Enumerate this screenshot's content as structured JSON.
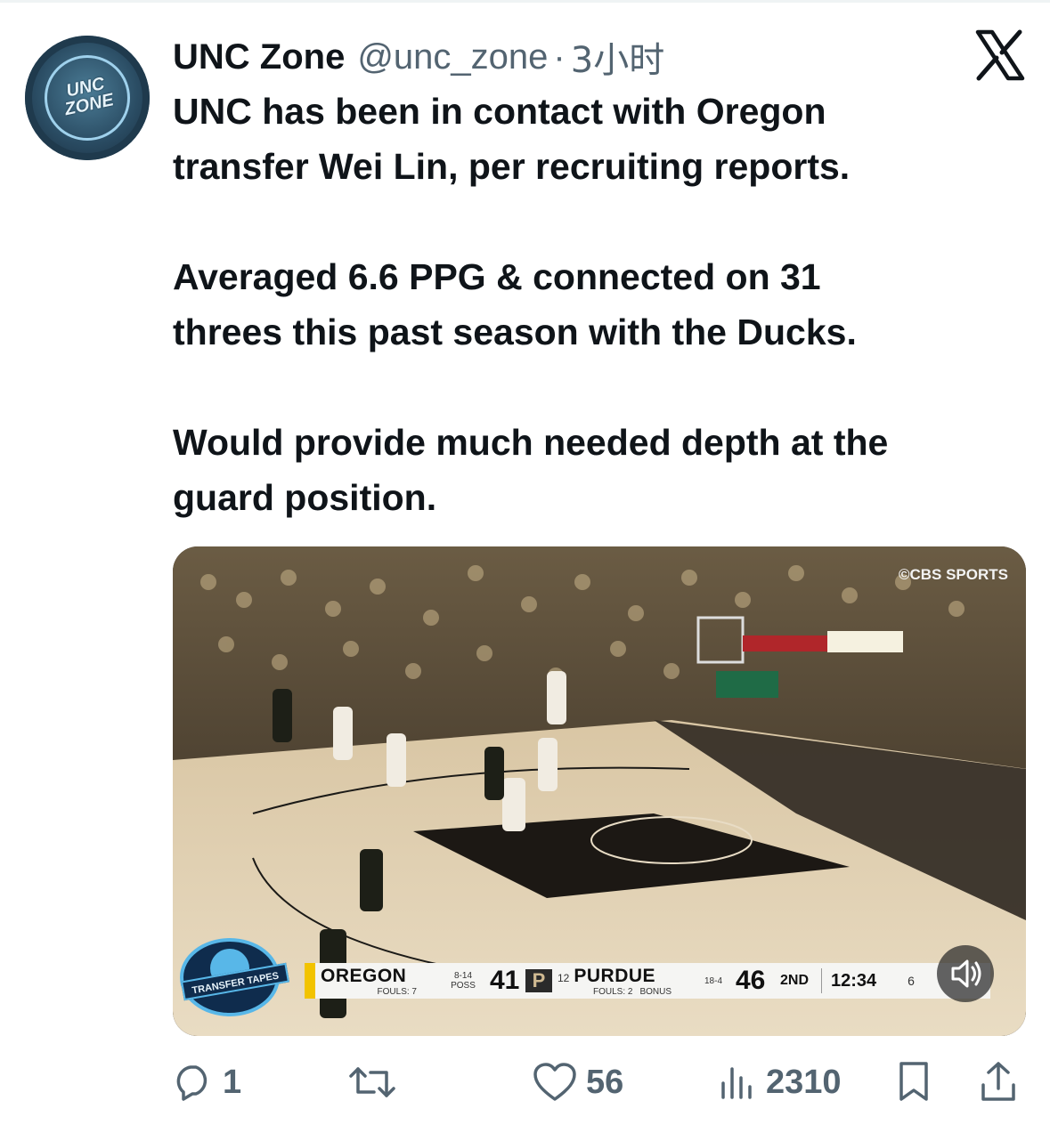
{
  "tweet": {
    "author_name": "UNC Zone",
    "handle": "@unc_zone",
    "separator": "·",
    "time": "3小时",
    "avatar_text": "UNC ZONE",
    "paragraphs": [
      [
        "UNC has been in contact with Oregon",
        "transfer Wei Lin, per recruiting reports."
      ],
      [
        "Averaged 6.6 PPG & connected on 31",
        "threes this past season with the Ducks."
      ],
      [
        "Would provide much needed depth at the",
        "guard position."
      ]
    ]
  },
  "video": {
    "watermark": "©CBS SPORTS",
    "badge": "TRANSFER TAPES",
    "scoreboard": {
      "team1": "OREGON",
      "team1_fouls": "FOULS: 7",
      "team1_record": "8-14",
      "team1_poss": "POSS",
      "team1_score": "41",
      "team2_rank": "12",
      "team2": "PURDUE",
      "team2_fouls": "FOULS: 2",
      "team2_bonus": "BONUS",
      "team2_record": "18-4",
      "team2_score": "46",
      "period": "2ND",
      "clock": "12:34",
      "shot_clock": "6"
    }
  },
  "actions": {
    "replies": "1",
    "retweets": "",
    "likes": "56",
    "views": "2310"
  }
}
